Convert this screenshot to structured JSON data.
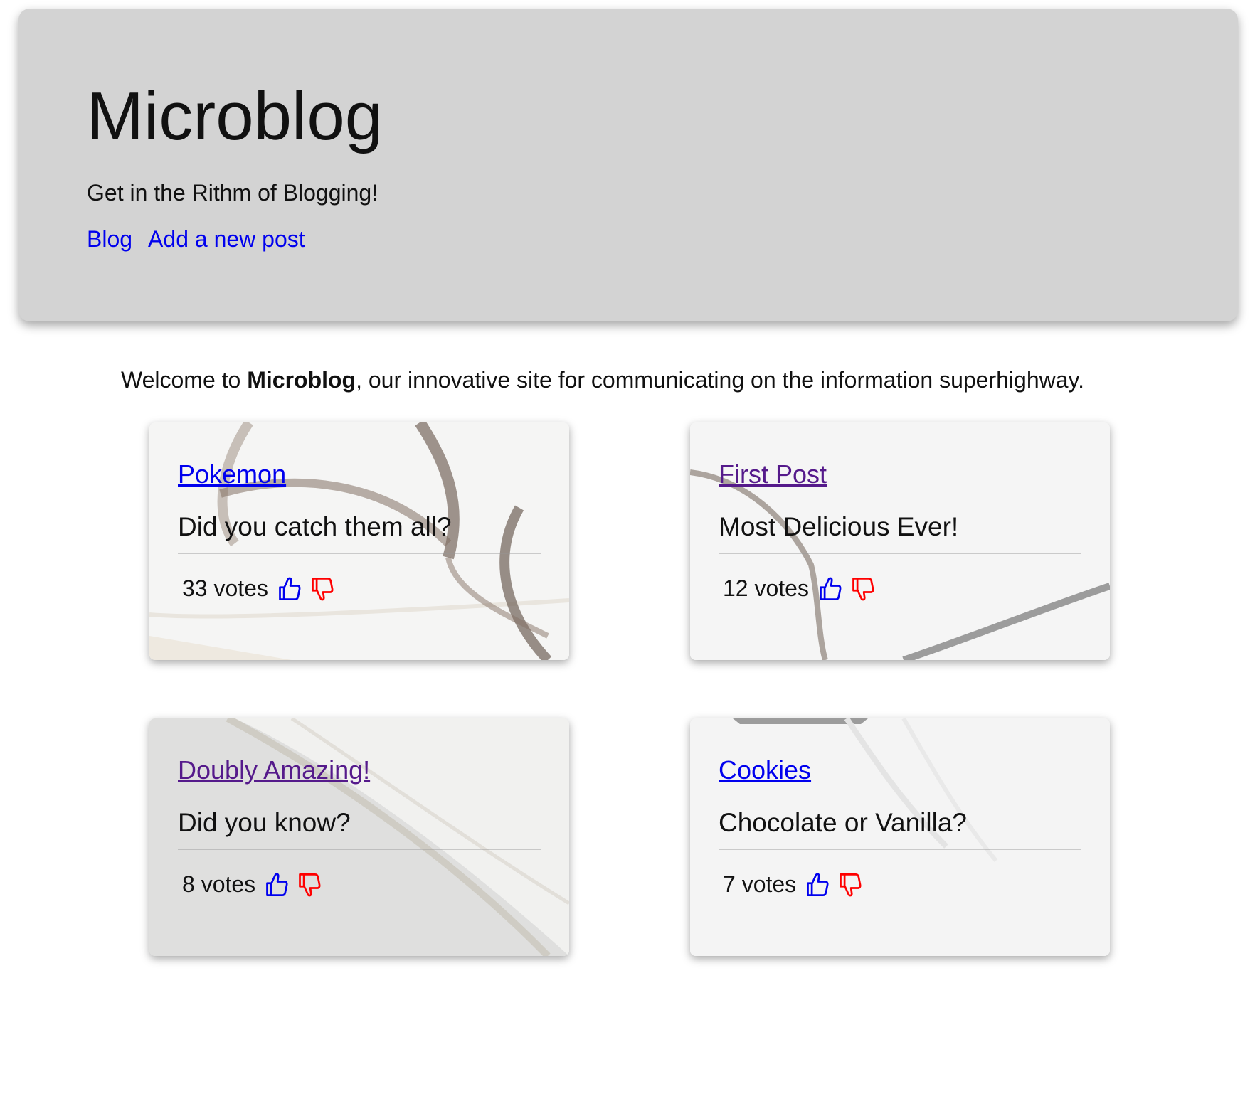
{
  "header": {
    "title": "Microblog",
    "tagline": "Get in the Rithm of Blogging!",
    "nav": [
      {
        "label": "Blog"
      },
      {
        "label": "Add a new post"
      }
    ]
  },
  "welcome": {
    "prefix": "Welcome to ",
    "brand": "Microblog",
    "suffix": ", our innovative site for communicating on the information superhighway."
  },
  "icons": {
    "upvote": "thumbs-up-icon",
    "downvote": "thumbs-down-icon"
  },
  "colors": {
    "upvote": "#0000ee",
    "downvote": "#ff0000",
    "link": "#0000ee",
    "visited_link": "#551a8b",
    "header_bg": "#d3d3d3"
  },
  "posts": [
    {
      "title": "Pokemon",
      "description": "Did you catch them all?",
      "votes": "33 votes",
      "visited": false
    },
    {
      "title": "First Post",
      "description": "Most Delicious Ever!",
      "votes": "12 votes",
      "visited": true
    },
    {
      "title": "Doubly Amazing!",
      "description": "Did you know?",
      "votes": "8 votes",
      "visited": true
    },
    {
      "title": "Cookies",
      "description": "Chocolate or Vanilla?",
      "votes": "7 votes",
      "visited": false
    }
  ]
}
